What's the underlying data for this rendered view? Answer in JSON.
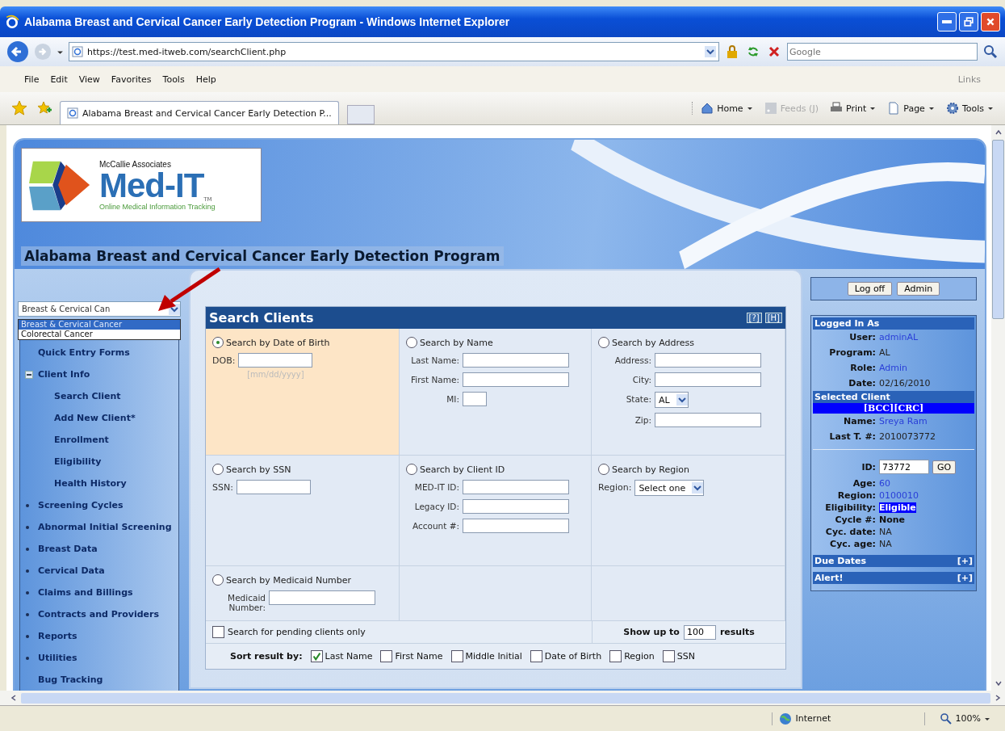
{
  "window": {
    "title": "Alabama Breast and Cervical Cancer Early Detection Program - Windows Internet Explorer"
  },
  "address_bar": {
    "url": "https://test.med-itweb.com/searchClient.php",
    "search_placeholder": "Google"
  },
  "menu": [
    "File",
    "Edit",
    "View",
    "Favorites",
    "Tools",
    "Help"
  ],
  "links_label": "Links",
  "tab": {
    "label": "Alabama Breast and Cervical Cancer Early Detection P..."
  },
  "toolbar": [
    {
      "kind": "home",
      "label": "Home",
      "disabled": false
    },
    {
      "kind": "feeds",
      "label": "Feeds (J)",
      "disabled": true
    },
    {
      "kind": "print",
      "label": "Print",
      "disabled": false
    },
    {
      "kind": "page",
      "label": "Page",
      "disabled": false
    },
    {
      "kind": "tools",
      "label": "Tools",
      "disabled": false
    }
  ],
  "logo": {
    "company": "McCallie Associates",
    "name": "Med-IT",
    "tm": "TM",
    "tagline": "Online Medical Information Tracking"
  },
  "program_title": "Alabama Breast and Cervical Cancer Early Detection Program",
  "program_select": {
    "value": "Breast & Cervical Can",
    "options": [
      {
        "label": "Breast & Cervical Cancer",
        "selected": true
      },
      {
        "label": "Colorectal Cancer",
        "selected": false
      }
    ]
  },
  "nav": [
    {
      "label": "Quick Entry Forms"
    },
    {
      "label": "Client Info",
      "expanded": true,
      "children": [
        {
          "label": "Search Client"
        },
        {
          "label": "Add New Client*"
        },
        {
          "label": "Enrollment"
        },
        {
          "label": "Eligibility"
        },
        {
          "label": "Health History"
        }
      ]
    },
    {
      "label": "Screening Cycles",
      "expanded": false
    },
    {
      "label": "Abnormal Initial Screening",
      "expanded": false
    },
    {
      "label": "Breast Data",
      "expanded": false
    },
    {
      "label": "Cervical Data",
      "expanded": false
    },
    {
      "label": "Claims and Billings",
      "expanded": false
    },
    {
      "label": "Contracts and Providers",
      "expanded": false
    },
    {
      "label": "Reports",
      "expanded": false
    },
    {
      "label": "Utilities",
      "expanded": false
    },
    {
      "label": "Bug Tracking"
    }
  ],
  "search_panel": {
    "title": "Search Clients",
    "header_buttons": [
      "[?]",
      "[H]"
    ],
    "sections": [
      {
        "title": "Search by Date of Birth",
        "selected": true,
        "kind": "inline",
        "fields": [
          {
            "label": "DOB:",
            "kind": "text",
            "hint": "[mm/dd/yyyy]"
          }
        ]
      },
      {
        "title": "Search by Name",
        "selected": false,
        "kind": "stacked",
        "fields": [
          {
            "label": "Last Name:",
            "kind": "text"
          },
          {
            "label": "First Name:",
            "kind": "text"
          },
          {
            "label": "MI:",
            "kind": "short"
          }
        ]
      },
      {
        "title": "Search by Address",
        "selected": false,
        "kind": "stacked",
        "fields": [
          {
            "label": "Address:",
            "kind": "text"
          },
          {
            "label": "City:",
            "kind": "text"
          },
          {
            "label": "State:",
            "kind": "select",
            "value": "AL"
          },
          {
            "label": "Zip:",
            "kind": "text"
          }
        ]
      },
      {
        "title": "Search by SSN",
        "selected": false,
        "kind": "inline",
        "fields": [
          {
            "label": "SSN:",
            "kind": "text"
          }
        ]
      },
      {
        "title": "Search by Client ID",
        "selected": false,
        "kind": "stacked",
        "fields": [
          {
            "label": "MED-IT ID:",
            "kind": "text"
          },
          {
            "label": "Legacy ID:",
            "kind": "text"
          },
          {
            "label": "Account #:",
            "kind": "text"
          }
        ]
      },
      {
        "title": "Search by Region",
        "selected": false,
        "kind": "inline",
        "fields": [
          {
            "label": "Region:",
            "kind": "select",
            "value": "Select one"
          }
        ]
      },
      {
        "title": "Search by Medicaid Number",
        "selected": false,
        "kind": "stacked",
        "fields": [
          {
            "label": "Medicaid Number:",
            "kind": "text"
          }
        ]
      }
    ],
    "pending": {
      "label": "Search for pending clients only",
      "checked": false
    },
    "show_up_to": {
      "label": "Show up to",
      "value": "100",
      "suffix": "results"
    },
    "sort": {
      "label": "Sort result by:",
      "options": [
        {
          "label": "Last Name",
          "checked": true
        },
        {
          "label": "First Name",
          "checked": false
        },
        {
          "label": "Middle Initial",
          "checked": false
        },
        {
          "label": "Date of Birth",
          "checked": false
        },
        {
          "label": "Region",
          "checked": false
        },
        {
          "label": "SSN",
          "checked": false
        }
      ]
    }
  },
  "session": {
    "buttons": [
      "Log off",
      "Admin"
    ],
    "groups": [
      {
        "title": "Logged In As",
        "rows": [
          {
            "label": "User:",
            "value": "adminAL",
            "kind": "link"
          },
          {
            "label": "Program:",
            "value": "AL",
            "kind": "plain"
          },
          {
            "label": "Role:",
            "value": "Admin",
            "kind": "link"
          },
          {
            "label": "Date:",
            "value": "02/16/2010",
            "kind": "plain"
          }
        ]
      },
      {
        "title": "Selected Client",
        "tags": "[BCC][CRC]",
        "rows": [
          {
            "label": "Name:",
            "value": "Sreya Ram",
            "kind": "link"
          },
          {
            "label": "Last T. #:",
            "value": "2010073772",
            "kind": "plain"
          }
        ]
      }
    ],
    "id_lookup": {
      "label": "ID:",
      "value": "73772",
      "button": "GO"
    },
    "details": [
      {
        "label": "Age:",
        "value": "60",
        "kind": "link"
      },
      {
        "label": "Region:",
        "value": "0100010",
        "kind": "link"
      },
      {
        "label": "Eligibility:",
        "value": "Eligible",
        "kind": "highlight"
      },
      {
        "label": "Cycle #:",
        "value": "None",
        "kind": "bold"
      },
      {
        "label": "Cyc. date:",
        "value": "NA",
        "kind": "plain"
      },
      {
        "label": "Cyc. age:",
        "value": "NA",
        "kind": "plain"
      }
    ],
    "collapsibles": [
      {
        "title": "Due Dates",
        "toggle": "[+]"
      },
      {
        "title": "Alert!",
        "toggle": "[+]"
      }
    ]
  },
  "status_bar": {
    "zone": "Internet",
    "zoom": "100%"
  }
}
